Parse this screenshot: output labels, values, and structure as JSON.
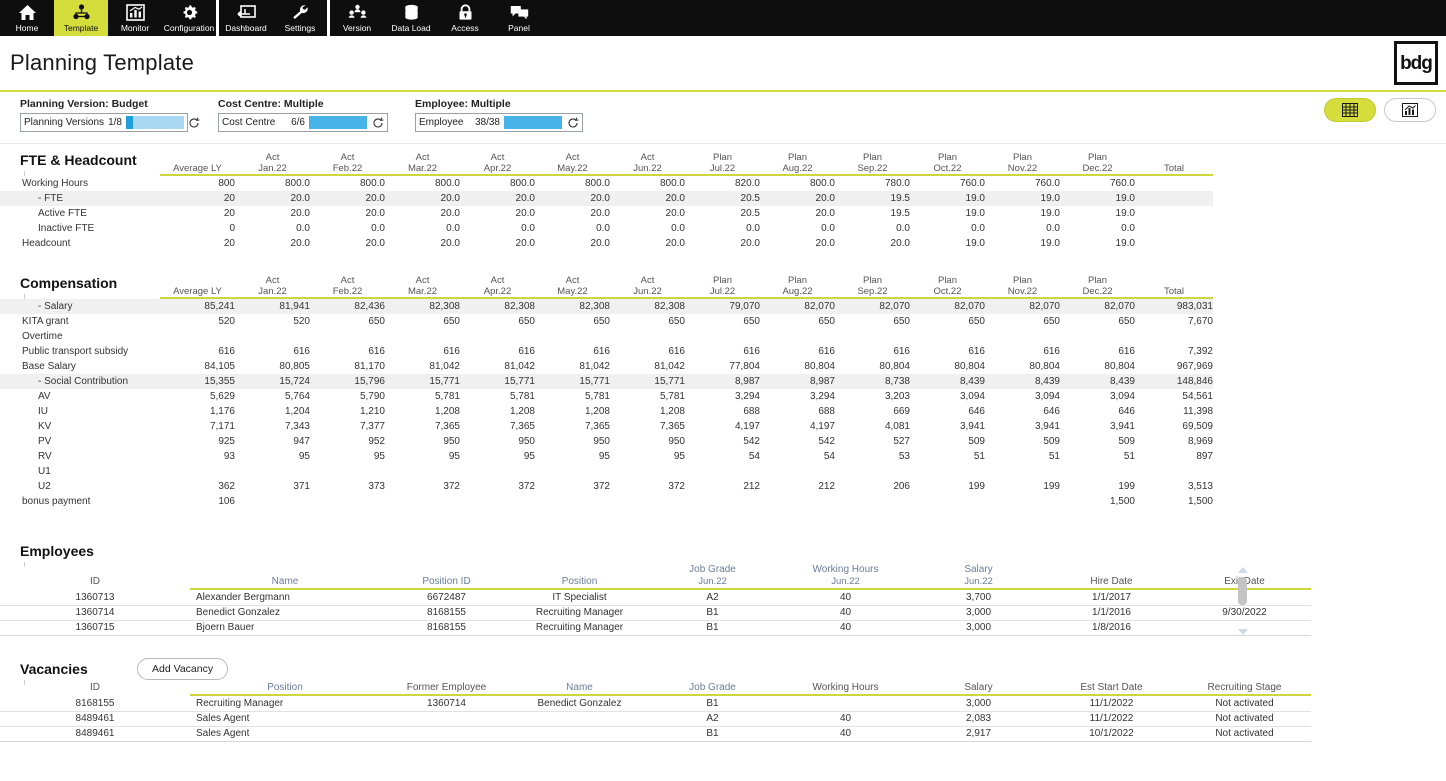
{
  "nav": {
    "groups": [
      {
        "items": [
          {
            "label": "Home",
            "icon": "home-icon",
            "active": false
          },
          {
            "label": "Template",
            "icon": "template-icon",
            "active": true
          },
          {
            "label": "Monitor",
            "icon": "monitor-chart-icon",
            "active": false
          },
          {
            "label": "Configuration",
            "icon": "gear-icon",
            "active": false
          }
        ]
      },
      {
        "items": [
          {
            "label": "Dashboard",
            "icon": "dashboard-icon",
            "active": false
          },
          {
            "label": "Settings",
            "icon": "wrench-icon",
            "active": false
          }
        ]
      },
      {
        "items": [
          {
            "label": "Version",
            "icon": "version-people-icon",
            "active": false
          },
          {
            "label": "Data Load",
            "icon": "database-icon",
            "active": false
          },
          {
            "label": "Access",
            "icon": "lock-icon",
            "active": false
          },
          {
            "label": "Panel",
            "icon": "panel-icon",
            "active": false
          }
        ]
      }
    ]
  },
  "header": {
    "title": "Planning Template",
    "logo": "bdg"
  },
  "filters": [
    {
      "label": "Planning Version: Budget",
      "name": "Planning Versions",
      "count": "1/8",
      "fill_ratio": 0.125
    },
    {
      "label": "Cost Centre: Multiple",
      "name": "Cost Centre",
      "count": "6/6",
      "fill_ratio": 1
    },
    {
      "label": "Employee: Multiple",
      "name": "Employee",
      "count": "38/38",
      "fill_ratio": 1
    }
  ],
  "view_toggle": [
    {
      "name": "table-view",
      "icon": "grid-icon",
      "active": true
    },
    {
      "name": "chart-view",
      "icon": "bar-chart-icon",
      "active": false
    }
  ],
  "colors": {
    "accent": "#d4dd3b",
    "rule": "#cdd63a",
    "bar": "#1f9ede",
    "bar_track": "#a9d8f2",
    "header_text": "#6b7d99"
  },
  "fte": {
    "title": "FTE & Headcount",
    "columns": [
      {
        "top": "",
        "bottom": "Average LY"
      },
      {
        "top": "Act",
        "bottom": "Jan.22"
      },
      {
        "top": "Act",
        "bottom": "Feb.22"
      },
      {
        "top": "Act",
        "bottom": "Mar.22"
      },
      {
        "top": "Act",
        "bottom": "Apr.22"
      },
      {
        "top": "Act",
        "bottom": "May.22"
      },
      {
        "top": "Act",
        "bottom": "Jun.22"
      },
      {
        "top": "Plan",
        "bottom": "Jul.22"
      },
      {
        "top": "Plan",
        "bottom": "Aug.22"
      },
      {
        "top": "Plan",
        "bottom": "Sep.22"
      },
      {
        "top": "Plan",
        "bottom": "Oct.22"
      },
      {
        "top": "Plan",
        "bottom": "Nov.22"
      },
      {
        "top": "Plan",
        "bottom": "Dec.22"
      },
      {
        "top": "",
        "bottom": "Total"
      }
    ],
    "rows": [
      {
        "label": "Working Hours",
        "indent": false,
        "agg": false,
        "values": [
          "800",
          "800.0",
          "800.0",
          "800.0",
          "800.0",
          "800.0",
          "800.0",
          "820.0",
          "800.0",
          "780.0",
          "760.0",
          "760.0",
          "760.0",
          ""
        ]
      },
      {
        "label": "- FTE",
        "indent": true,
        "agg": true,
        "values": [
          "20",
          "20.0",
          "20.0",
          "20.0",
          "20.0",
          "20.0",
          "20.0",
          "20.5",
          "20.0",
          "19.5",
          "19.0",
          "19.0",
          "19.0",
          ""
        ]
      },
      {
        "label": "Active FTE",
        "indent": true,
        "agg": false,
        "values": [
          "20",
          "20.0",
          "20.0",
          "20.0",
          "20.0",
          "20.0",
          "20.0",
          "20.5",
          "20.0",
          "19.5",
          "19.0",
          "19.0",
          "19.0",
          ""
        ]
      },
      {
        "label": "Inactive FTE",
        "indent": true,
        "agg": false,
        "values": [
          "0",
          "0.0",
          "0.0",
          "0.0",
          "0.0",
          "0.0",
          "0.0",
          "0.0",
          "0.0",
          "0.0",
          "0.0",
          "0.0",
          "0.0",
          ""
        ]
      },
      {
        "label": "Headcount",
        "indent": false,
        "agg": false,
        "values": [
          "20",
          "20.0",
          "20.0",
          "20.0",
          "20.0",
          "20.0",
          "20.0",
          "20.0",
          "20.0",
          "20.0",
          "19.0",
          "19.0",
          "19.0",
          ""
        ]
      }
    ]
  },
  "compensation": {
    "title": "Compensation",
    "columns": [
      {
        "top": "",
        "bottom": "Average LY"
      },
      {
        "top": "Act",
        "bottom": "Jan.22"
      },
      {
        "top": "Act",
        "bottom": "Feb.22"
      },
      {
        "top": "Act",
        "bottom": "Mar.22"
      },
      {
        "top": "Act",
        "bottom": "Apr.22"
      },
      {
        "top": "Act",
        "bottom": "May.22"
      },
      {
        "top": "Act",
        "bottom": "Jun.22"
      },
      {
        "top": "Plan",
        "bottom": "Jul.22"
      },
      {
        "top": "Plan",
        "bottom": "Aug.22"
      },
      {
        "top": "Plan",
        "bottom": "Sep.22"
      },
      {
        "top": "Plan",
        "bottom": "Oct.22"
      },
      {
        "top": "Plan",
        "bottom": "Nov.22"
      },
      {
        "top": "Plan",
        "bottom": "Dec.22"
      },
      {
        "top": "",
        "bottom": "Total"
      }
    ],
    "rows": [
      {
        "label": "- Salary",
        "indent": true,
        "agg": true,
        "values": [
          "85,241",
          "81,941",
          "82,436",
          "82,308",
          "82,308",
          "82,308",
          "82,308",
          "79,070",
          "82,070",
          "82,070",
          "82,070",
          "82,070",
          "82,070",
          "983,031"
        ]
      },
      {
        "label": "KITA grant",
        "indent": false,
        "agg": false,
        "values": [
          "520",
          "520",
          "650",
          "650",
          "650",
          "650",
          "650",
          "650",
          "650",
          "650",
          "650",
          "650",
          "650",
          "7,670"
        ]
      },
      {
        "label": "Overtime",
        "indent": false,
        "agg": false,
        "values": [
          "",
          "",
          "",
          "",
          "",
          "",
          "",
          "",
          "",
          "",
          "",
          "",
          "",
          ""
        ]
      },
      {
        "label": "Public transport subsidy",
        "indent": false,
        "agg": false,
        "values": [
          "616",
          "616",
          "616",
          "616",
          "616",
          "616",
          "616",
          "616",
          "616",
          "616",
          "616",
          "616",
          "616",
          "7,392"
        ]
      },
      {
        "label": "Base Salary",
        "indent": false,
        "agg": false,
        "values": [
          "84,105",
          "80,805",
          "81,170",
          "81,042",
          "81,042",
          "81,042",
          "81,042",
          "77,804",
          "80,804",
          "80,804",
          "80,804",
          "80,804",
          "80,804",
          "967,969"
        ]
      },
      {
        "label": "- Social Contribution",
        "indent": true,
        "agg": true,
        "values": [
          "15,355",
          "15,724",
          "15,796",
          "15,771",
          "15,771",
          "15,771",
          "15,771",
          "8,987",
          "8,987",
          "8,738",
          "8,439",
          "8,439",
          "8,439",
          "148,846"
        ]
      },
      {
        "label": "AV",
        "indent": true,
        "agg": false,
        "values": [
          "5,629",
          "5,764",
          "5,790",
          "5,781",
          "5,781",
          "5,781",
          "5,781",
          "3,294",
          "3,294",
          "3,203",
          "3,094",
          "3,094",
          "3,094",
          "54,561"
        ]
      },
      {
        "label": "IU",
        "indent": true,
        "agg": false,
        "values": [
          "1,176",
          "1,204",
          "1,210",
          "1,208",
          "1,208",
          "1,208",
          "1,208",
          "688",
          "688",
          "669",
          "646",
          "646",
          "646",
          "11,398"
        ]
      },
      {
        "label": "KV",
        "indent": true,
        "agg": false,
        "values": [
          "7,171",
          "7,343",
          "7,377",
          "7,365",
          "7,365",
          "7,365",
          "7,365",
          "4,197",
          "4,197",
          "4,081",
          "3,941",
          "3,941",
          "3,941",
          "69,509"
        ]
      },
      {
        "label": "PV",
        "indent": true,
        "agg": false,
        "values": [
          "925",
          "947",
          "952",
          "950",
          "950",
          "950",
          "950",
          "542",
          "542",
          "527",
          "509",
          "509",
          "509",
          "8,969"
        ]
      },
      {
        "label": "RV",
        "indent": true,
        "agg": false,
        "values": [
          "93",
          "95",
          "95",
          "95",
          "95",
          "95",
          "95",
          "54",
          "54",
          "53",
          "51",
          "51",
          "51",
          "897"
        ]
      },
      {
        "label": "U1",
        "indent": true,
        "agg": false,
        "values": [
          "",
          "",
          "",
          "",
          "",
          "",
          "",
          "",
          "",
          "",
          "",
          "",
          "",
          ""
        ]
      },
      {
        "label": "U2",
        "indent": true,
        "agg": false,
        "values": [
          "362",
          "371",
          "373",
          "372",
          "372",
          "372",
          "372",
          "212",
          "212",
          "206",
          "199",
          "199",
          "199",
          "3,513"
        ]
      },
      {
        "label": "bonus payment",
        "indent": false,
        "agg": false,
        "values": [
          "106",
          "",
          "",
          "",
          "",
          "",
          "",
          "",
          "",
          "",
          "",
          "",
          "1,500",
          "1,500"
        ]
      }
    ]
  },
  "employees": {
    "title": "Employees",
    "columns": [
      {
        "top": "ID",
        "bottom": "",
        "muted": false
      },
      {
        "top": "Name",
        "bottom": "",
        "muted": true
      },
      {
        "top": "Position ID",
        "bottom": "",
        "muted": true
      },
      {
        "top": "Position",
        "bottom": "",
        "muted": true
      },
      {
        "top": "Job Grade",
        "bottom": "Jun.22",
        "muted": true
      },
      {
        "top": "Working Hours",
        "bottom": "Jun.22",
        "muted": true
      },
      {
        "top": "Salary",
        "bottom": "Jun.22",
        "muted": true
      },
      {
        "top": "Hire Date",
        "bottom": "",
        "muted": false
      },
      {
        "top": "Exit Date",
        "bottom": "",
        "muted": false
      }
    ],
    "rows": [
      [
        "1360713",
        "Alexander Bergmann",
        "6672487",
        "IT Specialist",
        "A2",
        "40",
        "3,700",
        "1/1/2017",
        ""
      ],
      [
        "1360714",
        "Benedict Gonzalez",
        "8168155",
        "Recruiting Manager",
        "B1",
        "40",
        "3,000",
        "1/1/2016",
        "9/30/2022"
      ],
      [
        "1360715",
        "Bjoern Bauer",
        "8168155",
        "Recruiting Manager",
        "B1",
        "40",
        "3,000",
        "1/8/2016",
        ""
      ]
    ]
  },
  "vacancies": {
    "title": "Vacancies",
    "add_label": "Add Vacancy",
    "columns": [
      {
        "top": "ID",
        "bottom": "",
        "muted": false
      },
      {
        "top": "Position",
        "bottom": "",
        "muted": true
      },
      {
        "top": "Former Employee",
        "bottom": "",
        "muted": false
      },
      {
        "top": "Name",
        "bottom": "",
        "muted": true
      },
      {
        "top": "Job Grade",
        "bottom": "",
        "muted": true
      },
      {
        "top": "Working Hours",
        "bottom": "",
        "muted": false
      },
      {
        "top": "Salary",
        "bottom": "",
        "muted": false
      },
      {
        "top": "Est Start Date",
        "bottom": "",
        "muted": false
      },
      {
        "top": "Recruiting Stage",
        "bottom": "",
        "muted": false
      }
    ],
    "rows": [
      [
        "8168155",
        "Recruiting Manager",
        "1360714",
        "Benedict Gonzalez",
        "B1",
        "",
        "3,000",
        "11/1/2022",
        "Not activated"
      ],
      [
        "8489461",
        "Sales Agent",
        "",
        "",
        "A2",
        "40",
        "2,083",
        "11/1/2022",
        "Not activated"
      ],
      [
        "8489461",
        "Sales Agent",
        "",
        "",
        "B1",
        "40",
        "2,917",
        "10/1/2022",
        "Not activated"
      ]
    ]
  }
}
